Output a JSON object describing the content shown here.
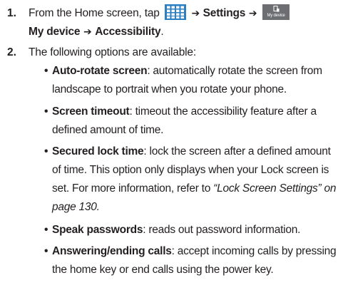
{
  "steps": [
    {
      "number": "1.",
      "prefix": "From the Home screen, tap ",
      "apps_icon": "apps-grid-icon",
      "arrow1": " ➔ ",
      "settings_label": "Settings",
      "arrow2": " ➔ ",
      "mydevice_icon_label": "My device",
      "line2_label": "My device",
      "arrow3": " ➔ ",
      "accessibility_label": "Accessibility",
      "suffix": "."
    },
    {
      "number": "2.",
      "text": "The following options are available:"
    }
  ],
  "options": [
    {
      "name": "Auto-rotate screen",
      "description": ": automatically rotate the screen from landscape to portrait when you rotate your phone."
    },
    {
      "name": "Screen timeout",
      "description": ": timeout the accessibility feature after a defined amount of time."
    },
    {
      "name": "Secured lock time",
      "description": ": lock the screen after a defined amount of time. This option only displays when your Lock screen is set. For more information, refer to ",
      "reference": "“Lock Screen Settings” on page 130.",
      "reference_suffix": ""
    },
    {
      "name": "Speak passwords",
      "description": ": reads out password information."
    },
    {
      "name": "Answering/ending calls",
      "description": ": accept incoming calls by pressing the home key or end calls using the power key."
    }
  ],
  "bullet_char": "•",
  "colors": {
    "text": "#231f20",
    "apps_icon_blue": "#2b7fc3",
    "mydevice_bg": "#6d6e71"
  }
}
